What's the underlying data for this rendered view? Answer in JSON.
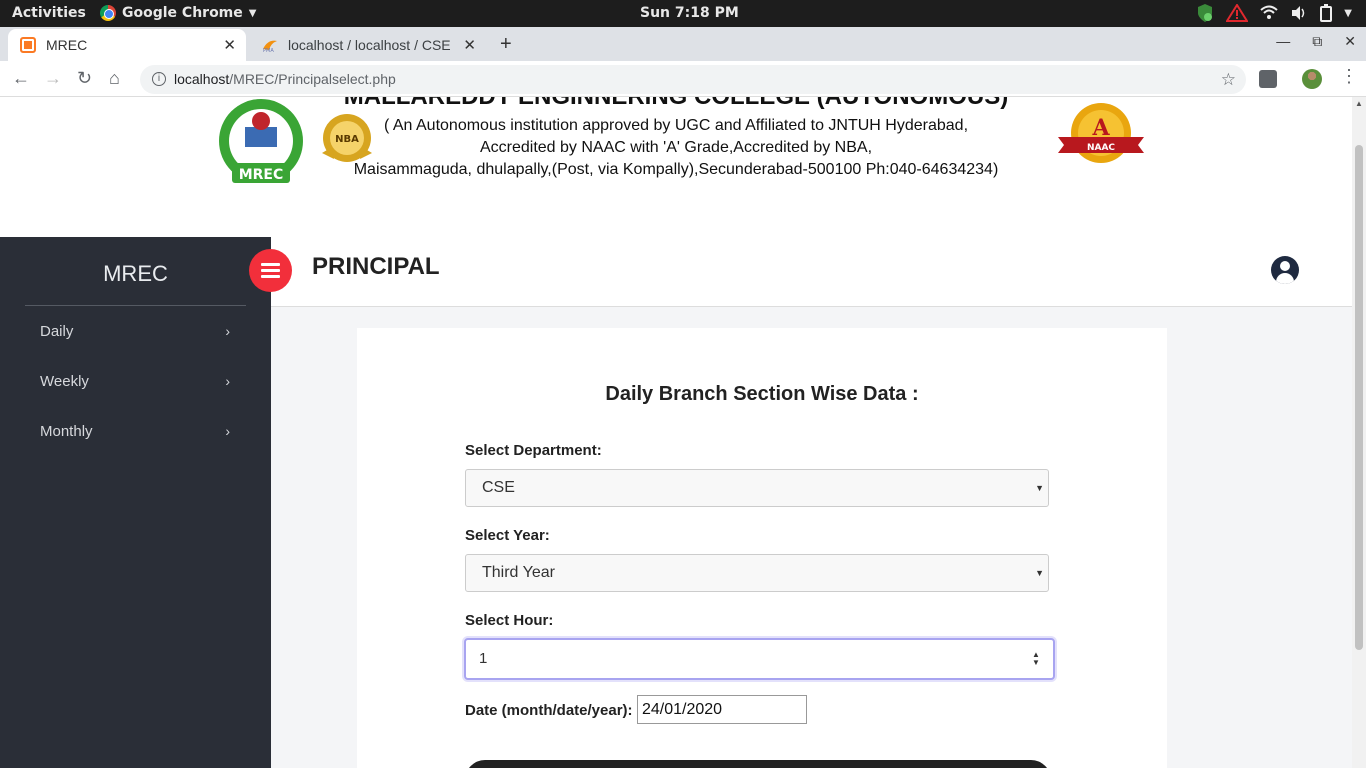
{
  "os_bar": {
    "activities": "Activities",
    "app_name": "Google Chrome",
    "clock": "Sun  7:18 PM"
  },
  "browser": {
    "tabs": [
      {
        "label": "MREC",
        "active": true
      },
      {
        "label": "localhost / localhost / CSE",
        "active": false
      }
    ],
    "url_host": "localhost",
    "url_path": "/MREC/Principalselect.php"
  },
  "header": {
    "college_name": "MALLAREDDY ENGINNERING COLLEGE (AUTONOMOUS)",
    "line1": "( An Autonomous institution approved by UGC and Affiliated to JNTUH Hyderabad,",
    "line2": "Accredited by NAAC with 'A' Grade,Accredited by NBA,",
    "line3": "Maisammaguda, dhulapally,(Post, via Kompally),Secunderabad-500100 Ph:040-64634234)",
    "nba_text": "NBA",
    "naac_grade": "A",
    "naac_text": "NAAC",
    "mrec_logo_text": "MREC"
  },
  "sidebar": {
    "brand": "MREC",
    "items": [
      {
        "label": "Daily"
      },
      {
        "label": "Weekly"
      },
      {
        "label": "Monthly"
      }
    ]
  },
  "main": {
    "title": "PRINCIPAL"
  },
  "form": {
    "heading": "Daily Branch Section Wise Data :",
    "department_label": "Select Department:",
    "department_value": "CSE",
    "year_label": "Select Year:",
    "year_value": "Third Year",
    "hour_label": "Select Hour:",
    "hour_value": "1",
    "date_label": "Date (month/date/year):",
    "date_value": "24/01/2020"
  },
  "colors": {
    "sidebar_bg": "#2a2e37",
    "toggle_red": "#f22f3b",
    "focus_outline": "#a8a4f0"
  }
}
